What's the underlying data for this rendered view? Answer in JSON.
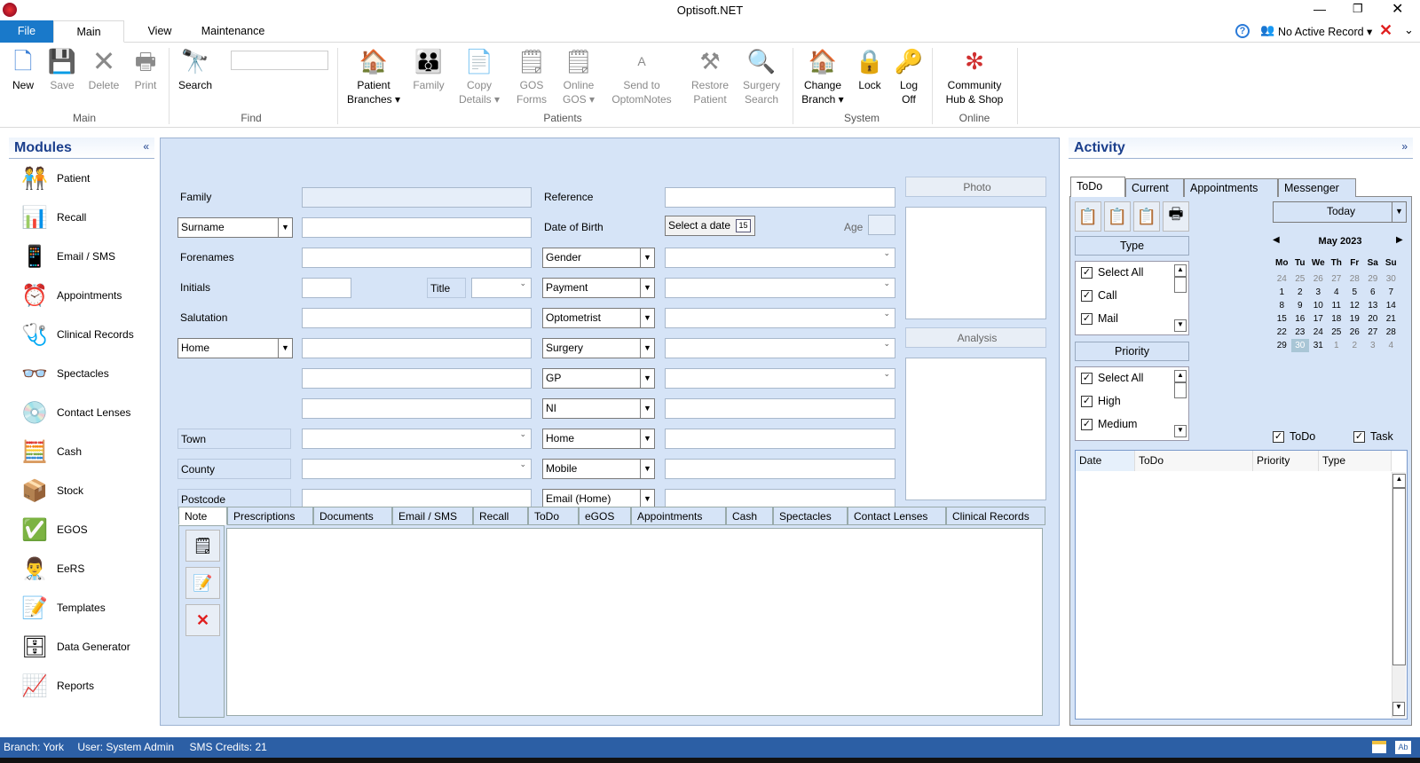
{
  "app": {
    "title": "Optisoft.NET",
    "logo": "NET"
  },
  "tabs": [
    "File",
    "Main",
    "View",
    "Maintenance"
  ],
  "header_right": {
    "help_icon": "help-icon",
    "record": "No Active Record"
  },
  "ribbon": {
    "main": [
      "New",
      "Save",
      "Delete",
      "Print"
    ],
    "find_button": "Search",
    "find_value": "",
    "patients": [
      [
        "Patient",
        "Branches ▾"
      ],
      [
        "Family",
        ""
      ],
      [
        "Copy",
        "Details ▾"
      ],
      [
        "GOS",
        "Forms"
      ],
      [
        "Online",
        "GOS ▾"
      ],
      [
        "Send to",
        "OptomNotes"
      ],
      [
        "Restore",
        "Patient"
      ],
      [
        "Surgery",
        "Search"
      ]
    ],
    "system": [
      [
        "Change",
        "Branch ▾"
      ],
      [
        "Lock",
        ""
      ],
      [
        "Log",
        "Off"
      ]
    ],
    "online": [
      [
        "Community",
        "Hub & Shop"
      ]
    ],
    "groups": {
      "main": "Main",
      "find": "Find",
      "patients": "Patients",
      "system": "System",
      "online": "Online"
    }
  },
  "modules": {
    "title": "Modules",
    "collapse": "«",
    "items": [
      "Patient",
      "Recall",
      "Email / SMS",
      "Appointments",
      "Clinical Records",
      "Spectacles",
      "Contact Lenses",
      "Cash",
      "Stock",
      "EGOS",
      "EeRS",
      "Templates",
      "Data Generator",
      "Reports"
    ]
  },
  "form": {
    "family": "Family",
    "surname": "Surname",
    "forenames": "Forenames",
    "initials": "Initials",
    "title": "Title",
    "salutation": "Salutation",
    "home": "Home",
    "town": "Town",
    "county": "County",
    "postcode": "Postcode",
    "reference": "Reference",
    "dob": "Date of Birth",
    "dob_placeholder": "Select a date",
    "cal_icon": "15",
    "age": "Age",
    "gender": "Gender",
    "payment": "Payment",
    "optometrist": "Optometrist",
    "surgery": "Surgery",
    "gp": "GP",
    "ni": "NI",
    "phone_home": "Home",
    "mobile": "Mobile",
    "email": "Email (Home)",
    "photo": "Photo",
    "analysis": "Analysis"
  },
  "bottom_tabs": [
    "Note",
    "Prescriptions",
    "Documents",
    "Email / SMS",
    "Recall",
    "ToDo",
    "eGOS",
    "Appointments",
    "Cash",
    "Spectacles",
    "Contact Lenses",
    "Clinical Records"
  ],
  "activity": {
    "title": "Activity",
    "expand": "»",
    "tabs": [
      "ToDo",
      "Current",
      "Appointments",
      "Messenger"
    ],
    "type_header": "Type",
    "type_items": [
      "Select All",
      "Call",
      "Mail"
    ],
    "priority_header": "Priority",
    "priority_items": [
      "Select All",
      "High",
      "Medium"
    ],
    "today": "Today",
    "month": "May 2023",
    "weekdays": [
      "Mo",
      "Tu",
      "We",
      "Th",
      "Fr",
      "Sa",
      "Su"
    ],
    "weeks": [
      [
        "24",
        "25",
        "26",
        "27",
        "28",
        "29",
        "30"
      ],
      [
        "1",
        "2",
        "3",
        "4",
        "5",
        "6",
        "7"
      ],
      [
        "8",
        "9",
        "10",
        "11",
        "12",
        "13",
        "14"
      ],
      [
        "15",
        "16",
        "17",
        "18",
        "19",
        "20",
        "21"
      ],
      [
        "22",
        "23",
        "24",
        "25",
        "26",
        "27",
        "28"
      ],
      [
        "29",
        "30",
        "31",
        "1",
        "2",
        "3",
        "4"
      ]
    ],
    "selected_day": "30",
    "toggles": [
      "ToDo",
      "Task"
    ],
    "columns": [
      "Date",
      "ToDo",
      "Priority",
      "Type"
    ]
  },
  "status": {
    "branch": "Branch: York",
    "user": "User: System Admin",
    "sms": "SMS Credits: 21"
  }
}
